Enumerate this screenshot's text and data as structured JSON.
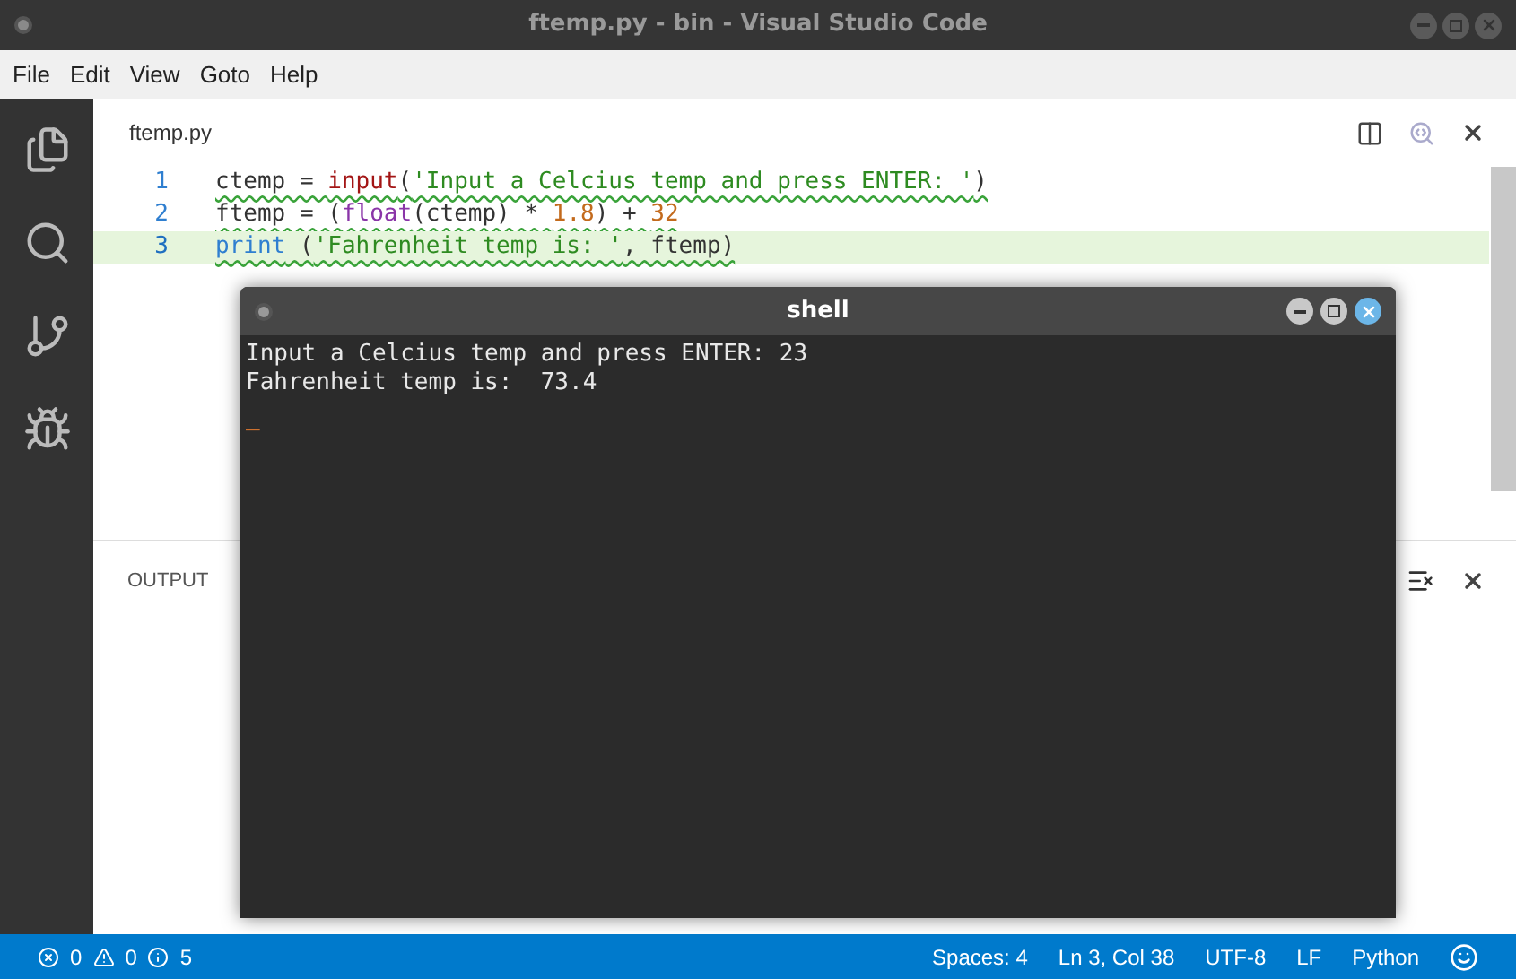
{
  "window": {
    "title": "ftemp.py - bin - Visual Studio Code"
  },
  "menu": [
    "File",
    "Edit",
    "View",
    "Goto",
    "Help"
  ],
  "editor": {
    "tab": "ftemp.py",
    "lines": [
      {
        "number": "1",
        "current": false,
        "warning": true,
        "tokens": [
          {
            "kind": "plain",
            "text": "ctemp = "
          },
          {
            "kind": "builtin",
            "text": "input"
          },
          {
            "kind": "plain",
            "text": "("
          },
          {
            "kind": "string",
            "text": "'Input a Celcius temp and press ENTER: '"
          },
          {
            "kind": "plain",
            "text": ")"
          }
        ]
      },
      {
        "number": "2",
        "current": false,
        "warning": true,
        "tokens": [
          {
            "kind": "plain",
            "text": "ftemp = ("
          },
          {
            "kind": "function",
            "text": "float"
          },
          {
            "kind": "plain",
            "text": "(ctemp) * "
          },
          {
            "kind": "number",
            "text": "1.8"
          },
          {
            "kind": "plain",
            "text": ") + "
          },
          {
            "kind": "number",
            "text": "32"
          }
        ]
      },
      {
        "number": "3",
        "current": true,
        "warning": true,
        "tokens": [
          {
            "kind": "keyword",
            "text": "print"
          },
          {
            "kind": "plain",
            "text": " ("
          },
          {
            "kind": "string",
            "text": "'Fahrenheit temp is: '"
          },
          {
            "kind": "plain",
            "text": ", ftemp)"
          }
        ]
      }
    ]
  },
  "panel": {
    "title": "OUTPUT"
  },
  "shell": {
    "title": "shell",
    "lines": [
      "Input a Celcius temp and press ENTER: 23",
      "Fahrenheit temp is:  73.4"
    ],
    "cursor": "_"
  },
  "status_bar": {
    "errors": "0",
    "warnings": "0",
    "infos": "5",
    "items": [
      "Spaces: 4",
      "Ln 3, Col 38",
      "UTF-8",
      "LF",
      "Python"
    ]
  }
}
